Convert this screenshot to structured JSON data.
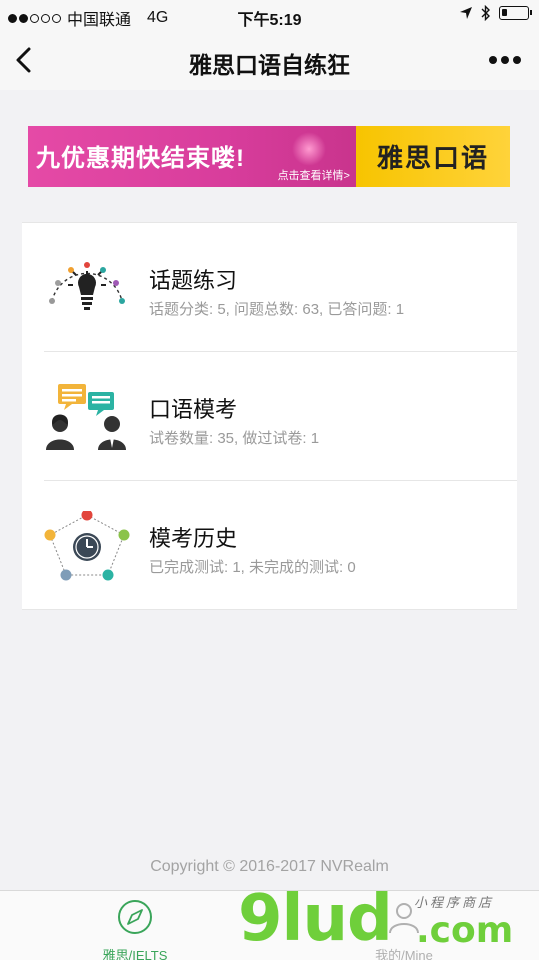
{
  "status_bar": {
    "carrier": "中国联通",
    "network": "4G",
    "time": "下午5:19",
    "battery_level": 0.2
  },
  "navbar": {
    "title": "雅思口语自练狂",
    "back_icon": "chevron-left-icon",
    "more_icon": "more-dots-icon"
  },
  "banner": {
    "main_text": "九优惠期快结束喽!",
    "sub_text": "点击查看详情>",
    "right_text": "雅思口语",
    "colors": {
      "left": "#d83d9c",
      "right": "#f7c400"
    }
  },
  "menu": {
    "items": [
      {
        "title": "话题练习",
        "desc": "话题分类: 5, 问题总数: 63, 已答问题: 1",
        "icon": "lightbulb-icon"
      },
      {
        "title": "口语模考",
        "desc": "试卷数量: 35, 做过试卷: 1",
        "icon": "conversation-icon"
      },
      {
        "title": "模考历史",
        "desc": "已完成测试: 1, 未完成的测试: 0",
        "icon": "clock-history-icon"
      }
    ]
  },
  "copyright": "Copyright © 2016-2017 NVRealm",
  "tabbar": {
    "tabs": [
      {
        "label": "雅思/IELTS",
        "icon": "compass-icon",
        "active": true
      },
      {
        "label": "我的/Mine",
        "icon": "user-icon",
        "active": false
      }
    ],
    "colors": {
      "active": "#3aa55a",
      "inactive": "#b0b0b0"
    }
  },
  "watermark": {
    "main": "9lud",
    "suffix": ".com",
    "tag": "小程序商店"
  }
}
